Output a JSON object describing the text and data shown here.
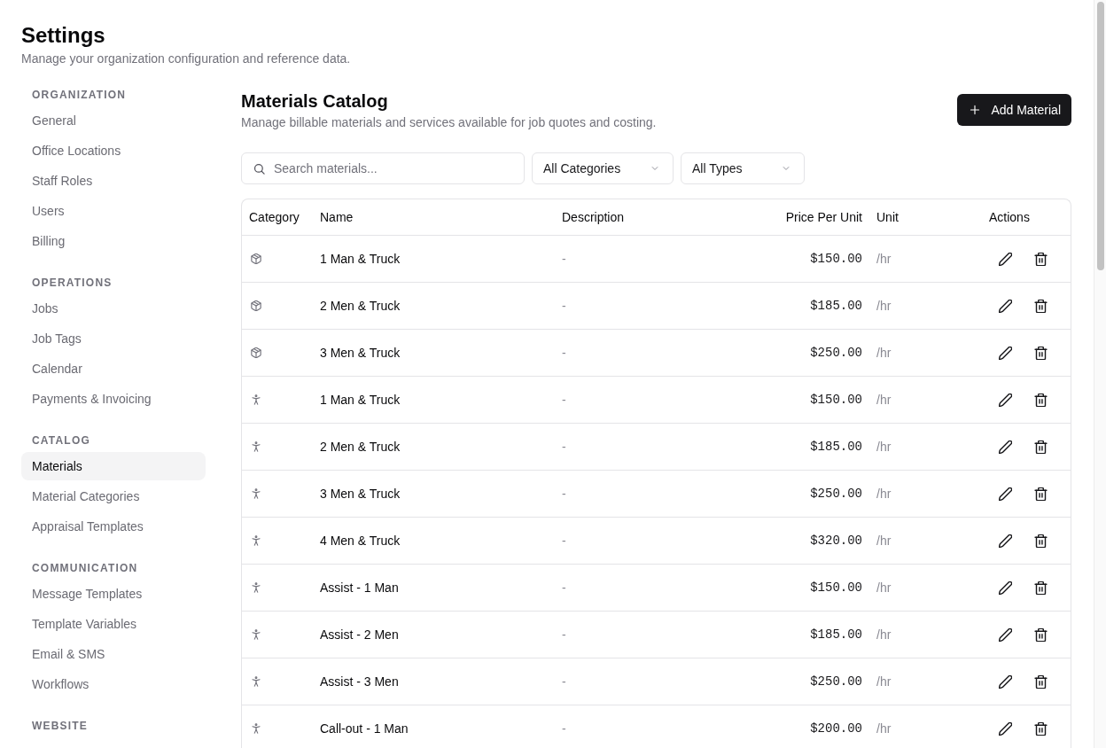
{
  "page": {
    "title": "Settings",
    "subtitle": "Manage your organization configuration and reference data."
  },
  "sidebar": {
    "sections": [
      {
        "heading": "ORGANIZATION",
        "items": [
          {
            "label": "General",
            "selected": false
          },
          {
            "label": "Office Locations",
            "selected": false
          },
          {
            "label": "Staff Roles",
            "selected": false
          },
          {
            "label": "Users",
            "selected": false
          },
          {
            "label": "Billing",
            "selected": false
          }
        ]
      },
      {
        "heading": "OPERATIONS",
        "items": [
          {
            "label": "Jobs",
            "selected": false
          },
          {
            "label": "Job Tags",
            "selected": false
          },
          {
            "label": "Calendar",
            "selected": false
          },
          {
            "label": "Payments & Invoicing",
            "selected": false
          }
        ]
      },
      {
        "heading": "CATALOG",
        "items": [
          {
            "label": "Materials",
            "selected": true
          },
          {
            "label": "Material Categories",
            "selected": false
          },
          {
            "label": "Appraisal Templates",
            "selected": false
          }
        ]
      },
      {
        "heading": "COMMUNICATION",
        "items": [
          {
            "label": "Message Templates",
            "selected": false
          },
          {
            "label": "Template Variables",
            "selected": false
          },
          {
            "label": "Email & SMS",
            "selected": false
          },
          {
            "label": "Workflows",
            "selected": false
          }
        ]
      },
      {
        "heading": "WEBSITE"
      }
    ]
  },
  "main": {
    "title": "Materials Catalog",
    "subtitle": "Manage billable materials and services available for job quotes and costing.",
    "add_button": {
      "label": "Add Material"
    },
    "search": {
      "placeholder": "Search materials..."
    },
    "filters": [
      {
        "value": "All Categories"
      },
      {
        "value": "All Types"
      }
    ]
  },
  "table": {
    "columns": [
      "Category",
      "Name",
      "Description",
      "Price Per Unit",
      "Unit",
      "Actions"
    ],
    "rows": [
      {
        "kind": "package",
        "name": "1 Man & Truck",
        "description": "-",
        "price": "$150.00",
        "unit": "/hr"
      },
      {
        "kind": "package",
        "name": "2 Men & Truck",
        "description": "-",
        "price": "$185.00",
        "unit": "/hr"
      },
      {
        "kind": "package",
        "name": "3 Men & Truck",
        "description": "-",
        "price": "$250.00",
        "unit": "/hr"
      },
      {
        "kind": "person",
        "name": "1 Man & Truck",
        "description": "-",
        "price": "$150.00",
        "unit": "/hr"
      },
      {
        "kind": "person",
        "name": "2 Men & Truck",
        "description": "-",
        "price": "$185.00",
        "unit": "/hr"
      },
      {
        "kind": "person",
        "name": "3 Men & Truck",
        "description": "-",
        "price": "$250.00",
        "unit": "/hr"
      },
      {
        "kind": "person",
        "name": "4 Men & Truck",
        "description": "-",
        "price": "$320.00",
        "unit": "/hr"
      },
      {
        "kind": "person",
        "name": "Assist - 1 Man",
        "description": "-",
        "price": "$150.00",
        "unit": "/hr"
      },
      {
        "kind": "person",
        "name": "Assist - 2 Men",
        "description": "-",
        "price": "$185.00",
        "unit": "/hr"
      },
      {
        "kind": "person",
        "name": "Assist - 3 Men",
        "description": "-",
        "price": "$250.00",
        "unit": "/hr"
      },
      {
        "kind": "person",
        "name": "Call-out - 1 Man",
        "description": "-",
        "price": "$200.00",
        "unit": "/hr"
      }
    ]
  }
}
